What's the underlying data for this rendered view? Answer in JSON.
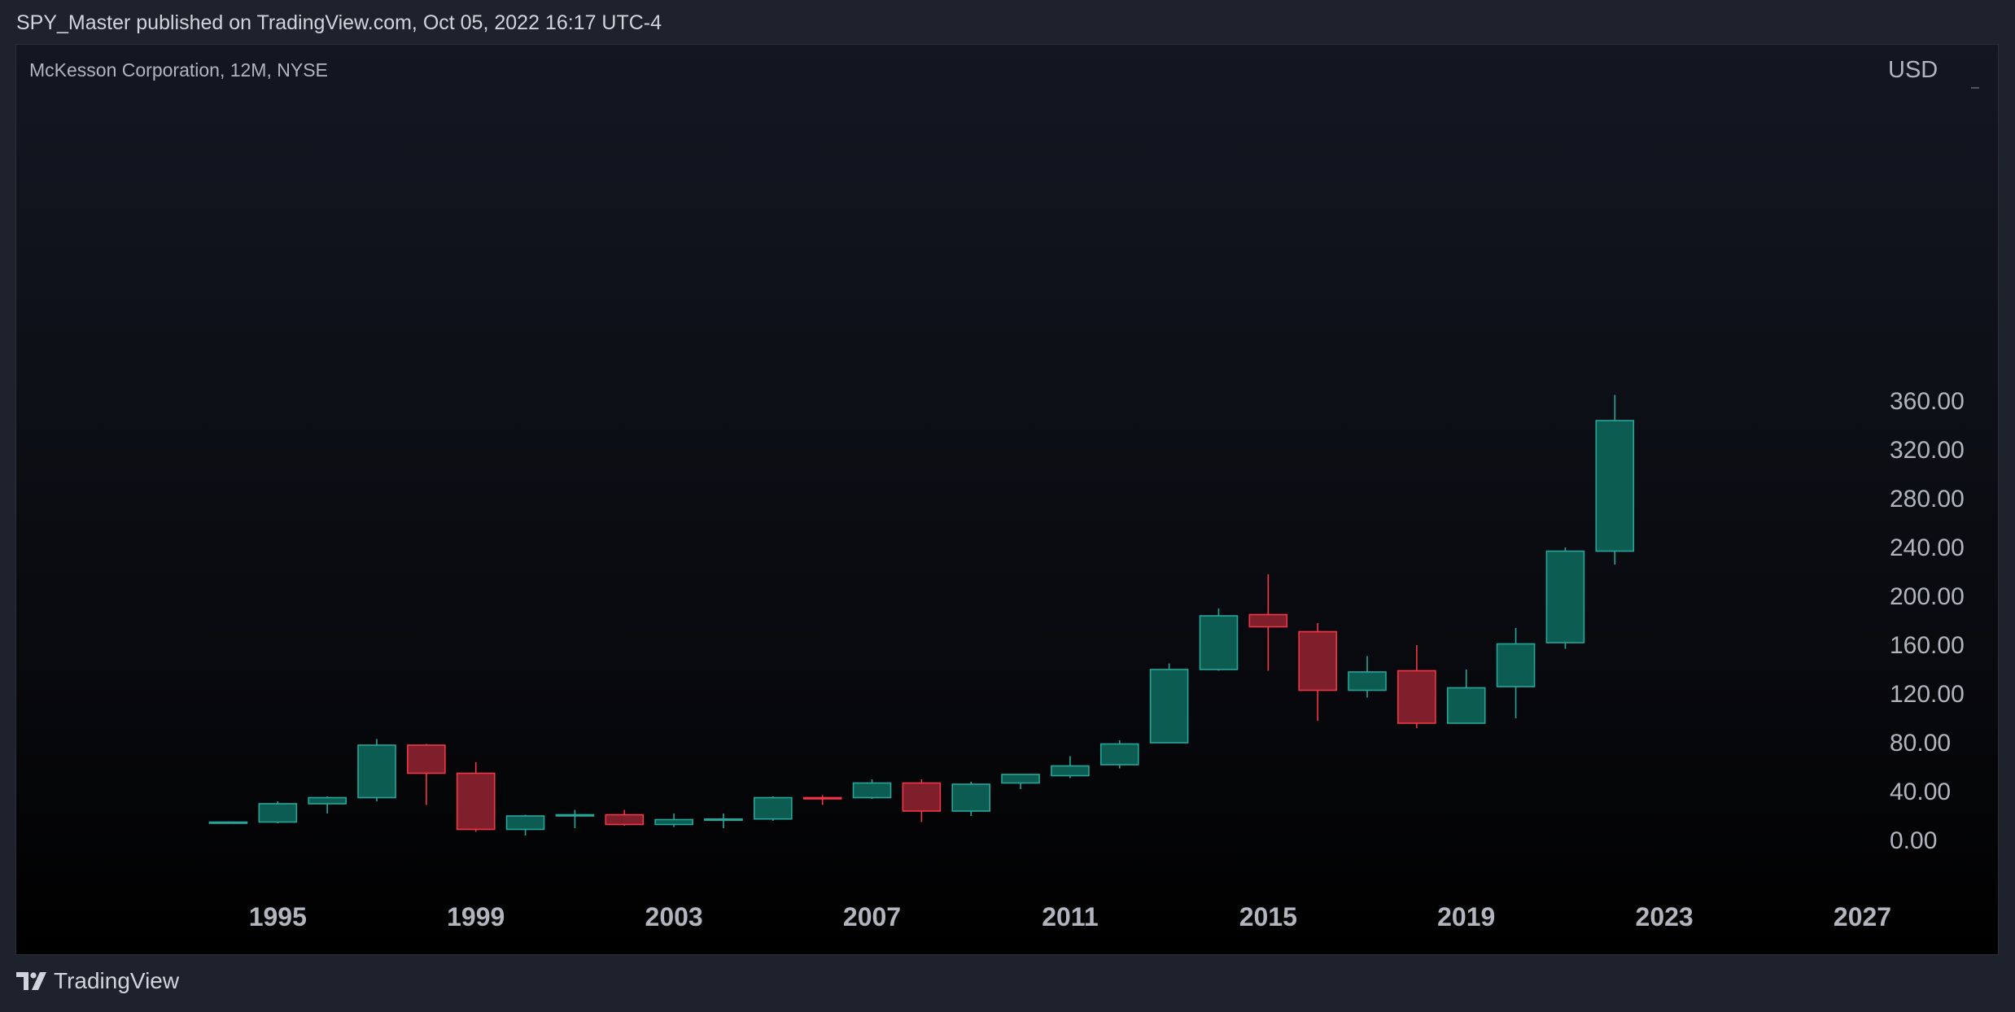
{
  "header": {
    "published_text": "SPY_Master published on TradingView.com, Oct 05, 2022 16:17 UTC-4"
  },
  "legend": {
    "symbol_text": "McKesson Corporation, 12M, NYSE"
  },
  "currency_label": "USD",
  "footer": {
    "brand": "TradingView",
    "icon": "tradingview-logo-icon"
  },
  "colors": {
    "up": "#26a69a",
    "up_fill": "#0c5c52",
    "down": "#f23645",
    "down_fill": "#7e1f2b",
    "axis_text": "#b2b5be"
  },
  "chart_data": {
    "type": "candlestick",
    "title": "McKesson Corporation, 12M, NYSE",
    "ylabel": "USD",
    "ylim": [
      -15,
      395
    ],
    "xlim": [
      1990.4,
      2028.3
    ],
    "y_ticks": [
      "0.00",
      "40.00",
      "80.00",
      "120.00",
      "160.00",
      "200.00",
      "240.00",
      "280.00",
      "320.00",
      "360.00"
    ],
    "x_ticks": [
      "1995",
      "1999",
      "2003",
      "2007",
      "2011",
      "2015",
      "2019",
      "2023",
      "2027"
    ],
    "grid": false,
    "candles": [
      {
        "year": 1994,
        "open": 24.5,
        "high": 25.5,
        "low": 24,
        "close": 25
      },
      {
        "year": 1995,
        "open": 25,
        "high": 42,
        "low": 24,
        "close": 40
      },
      {
        "year": 1996,
        "open": 40,
        "high": 46,
        "low": 32,
        "close": 45
      },
      {
        "year": 1997,
        "open": 45,
        "high": 93,
        "low": 42,
        "close": 88
      },
      {
        "year": 1998,
        "open": 88,
        "high": 89,
        "low": 39,
        "close": 65
      },
      {
        "year": 1999,
        "open": 65,
        "high": 74,
        "low": 17,
        "close": 19
      },
      {
        "year": 2000,
        "open": 19,
        "high": 31,
        "low": 14,
        "close": 30
      },
      {
        "year": 2001,
        "open": 30,
        "high": 35,
        "low": 20,
        "close": 31
      },
      {
        "year": 2002,
        "open": 31,
        "high": 35,
        "low": 22,
        "close": 23
      },
      {
        "year": 2003,
        "open": 23,
        "high": 32,
        "low": 21,
        "close": 27
      },
      {
        "year": 2004,
        "open": 27,
        "high": 32,
        "low": 20,
        "close": 27.5
      },
      {
        "year": 2005,
        "open": 27.5,
        "high": 46,
        "low": 26,
        "close": 45
      },
      {
        "year": 2006,
        "open": 45,
        "high": 47,
        "low": 39,
        "close": 44.5
      },
      {
        "year": 2007,
        "open": 45,
        "high": 60,
        "low": 44,
        "close": 57
      },
      {
        "year": 2008,
        "open": 57,
        "high": 60,
        "low": 25,
        "close": 34
      },
      {
        "year": 2009,
        "open": 34,
        "high": 58,
        "low": 30,
        "close": 56
      },
      {
        "year": 2010,
        "open": 57,
        "high": 64,
        "low": 52,
        "close": 64
      },
      {
        "year": 2011,
        "open": 63,
        "high": 79,
        "low": 61,
        "close": 71
      },
      {
        "year": 2012,
        "open": 72,
        "high": 92,
        "low": 69,
        "close": 89
      },
      {
        "year": 2013,
        "open": 90,
        "high": 155,
        "low": 90,
        "close": 150
      },
      {
        "year": 2014,
        "open": 150,
        "high": 200,
        "low": 149,
        "close": 194
      },
      {
        "year": 2015,
        "open": 195,
        "high": 228,
        "low": 149,
        "close": 185
      },
      {
        "year": 2016,
        "open": 181,
        "high": 188,
        "low": 108,
        "close": 133
      },
      {
        "year": 2017,
        "open": 133,
        "high": 161,
        "low": 127,
        "close": 148
      },
      {
        "year": 2018,
        "open": 149,
        "high": 170,
        "low": 102,
        "close": 106
      },
      {
        "year": 2019,
        "open": 106,
        "high": 150,
        "low": 106,
        "close": 135
      },
      {
        "year": 2020,
        "open": 136,
        "high": 184,
        "low": 110,
        "close": 171
      },
      {
        "year": 2021,
        "open": 172,
        "high": 250,
        "low": 167,
        "close": 247
      },
      {
        "year": 2022,
        "open": 247,
        "high": 375,
        "low": 236,
        "close": 354
      }
    ]
  }
}
